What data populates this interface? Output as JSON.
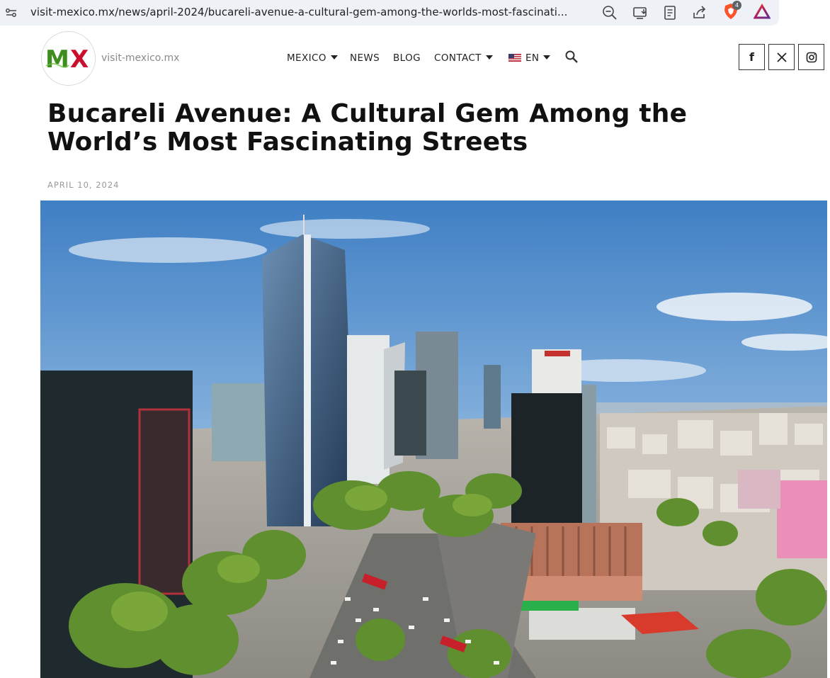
{
  "browser": {
    "url": "visit-mexico.mx/news/april-2024/bucareli-avenue-a-cultural-gem-among-the-worlds-most-fascinati...",
    "extension_badge_count": "4",
    "icons": [
      "tune-icon",
      "zoom-out-icon",
      "install-app-icon",
      "reader-mode-icon",
      "share-icon",
      "brave-shields-icon",
      "brave-rewards-icon"
    ]
  },
  "site": {
    "logo_text": "MX",
    "name": "visit-mexico.mx",
    "colors": {
      "logo_green": "#3e8e1e",
      "logo_red": "#c8102e"
    }
  },
  "nav": {
    "items": [
      {
        "label": "MEXICO",
        "dropdown": true
      },
      {
        "label": "NEWS",
        "dropdown": false
      },
      {
        "label": "BLOG",
        "dropdown": false
      },
      {
        "label": "CONTACT",
        "dropdown": true
      }
    ],
    "language": {
      "label": "EN",
      "flag": "us-flag-icon",
      "dropdown": true
    },
    "search_icon": "search-icon"
  },
  "social": [
    {
      "label": "f",
      "icon": "facebook-icon"
    },
    {
      "label": "𝕏",
      "icon": "x-icon"
    },
    {
      "label": "",
      "icon": "instagram-icon"
    }
  ],
  "article": {
    "title": "Bucareli Avenue: A Cultural Gem Among the World’s Most Fascinating Streets",
    "date": "APRIL 10, 2024",
    "hero_image": "aerial-city-avenue-photo"
  }
}
